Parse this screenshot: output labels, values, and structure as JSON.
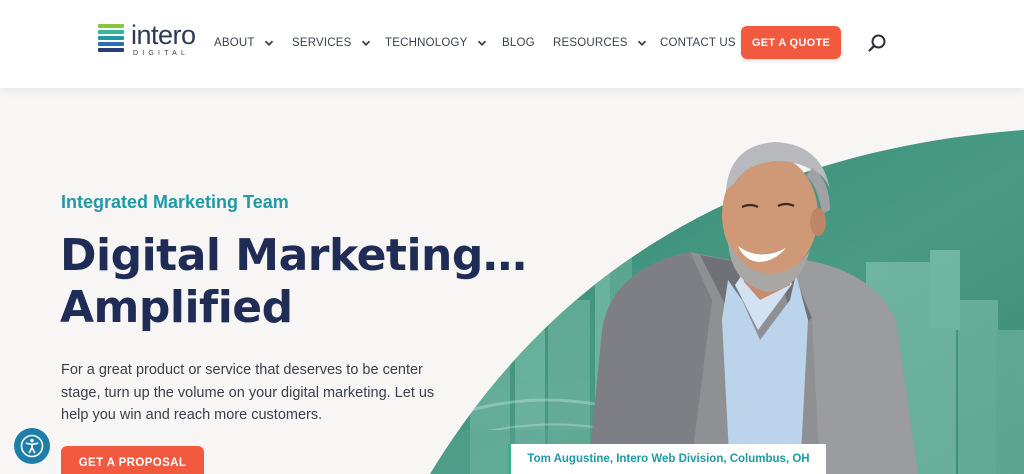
{
  "header": {
    "logo": {
      "word": "intero",
      "sub": "DIGITAL"
    },
    "nav": [
      {
        "label": "ABOUT",
        "has_dropdown": true
      },
      {
        "label": "SERVICES",
        "has_dropdown": true
      },
      {
        "label": "TECHNOLOGY",
        "has_dropdown": true
      },
      {
        "label": "BLOG",
        "has_dropdown": false
      },
      {
        "label": "RESOURCES",
        "has_dropdown": true
      },
      {
        "label": "CONTACT US",
        "has_dropdown": false
      }
    ],
    "cta_label": "GET A QUOTE",
    "search_icon": "search-icon"
  },
  "hero": {
    "eyebrow": "Integrated Marketing Team",
    "headline_line1": "Digital Marketing…",
    "headline_line2": "Amplified",
    "body": "For a great product or service that deserves to be center stage, turn up the volume on your digital marketing. Let us help you win and reach more customers.",
    "cta_label": "GET A PROPOSAL",
    "photo_caption": "Tom Augustine, Intero Web Division, Columbus, OH"
  },
  "accessibility_icon": "accessibility-icon",
  "colors": {
    "accent": "#f15a3f",
    "teal": "#1f9aa6",
    "navy": "#1f2c55",
    "hero_green": "#3f8f78"
  }
}
